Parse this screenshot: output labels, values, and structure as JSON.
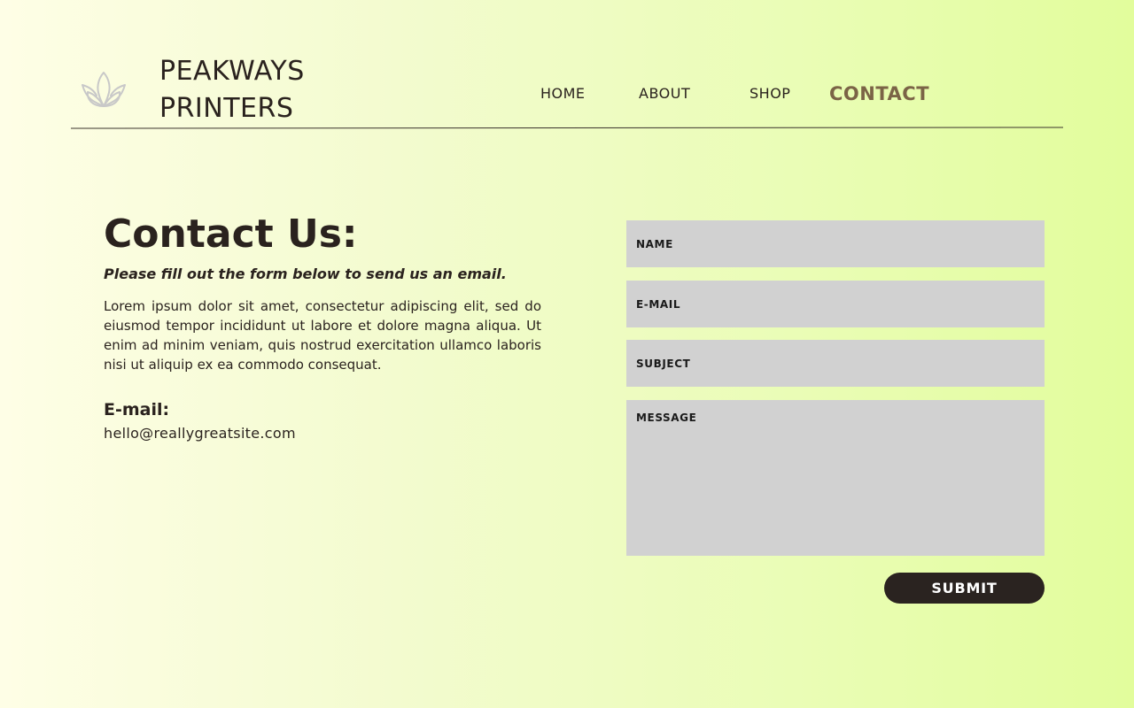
{
  "header": {
    "logo_icon": "lotus-icon",
    "brand_line1": "PEAKWAYS",
    "brand_line2": "PRINTERS",
    "nav": {
      "home": "HOME",
      "about": "ABOUT",
      "shop": "SHOP",
      "contact": "CONTACT",
      "active": "CONTACT"
    }
  },
  "main": {
    "title": "Contact Us:",
    "subtitle": "Please fill out the form below to send us an email.",
    "body": "Lorem ipsum dolor sit amet, consectetur adipiscing elit, sed do eiusmod tempor incididunt ut labore et dolore magna aliqua. Ut enim ad minim veniam, quis nostrud exercitation ullamco laboris nisi ut aliquip ex ea commodo consequat.",
    "email_heading": "E-mail:",
    "email_value": "hello@reallygreatsite.com"
  },
  "form": {
    "name_placeholder": "NAME",
    "email_placeholder": "E-MAIL",
    "subject_placeholder": "SUBJECT",
    "message_placeholder": "MESSAGE",
    "name_value": "",
    "email_value": "",
    "subject_value": "",
    "message_value": "",
    "submit_label": "SUBMIT"
  },
  "colors": {
    "text": "#2a221e",
    "active_nav": "#7b6446",
    "field_bg": "#d1d1d1",
    "button_bg": "#2a2320",
    "button_text": "#ffffff",
    "logo_stroke": "#c8c8c8",
    "background_left": "#fefee6",
    "background_right": "#e2fd9c"
  }
}
